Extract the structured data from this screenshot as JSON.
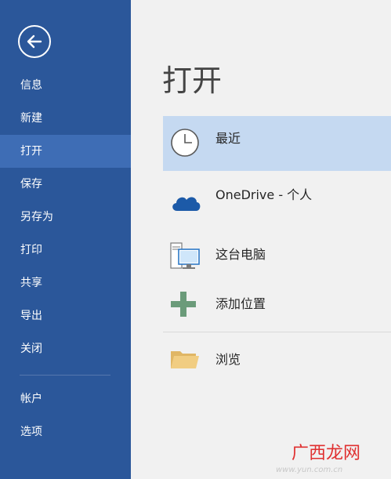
{
  "sidebar": {
    "back_icon": "back-arrow-icon",
    "items": [
      {
        "label": "信息"
      },
      {
        "label": "新建"
      },
      {
        "label": "打开",
        "active": true
      },
      {
        "label": "保存"
      },
      {
        "label": "另存为"
      },
      {
        "label": "打印"
      },
      {
        "label": "共享"
      },
      {
        "label": "导出"
      },
      {
        "label": "关闭"
      }
    ],
    "bottom_items": [
      {
        "label": "帐户"
      },
      {
        "label": "选项"
      }
    ]
  },
  "main": {
    "title": "打开",
    "locations": [
      {
        "label": "最近",
        "icon": "clock-icon",
        "selected": true
      },
      {
        "label": "OneDrive - 个人",
        "icon": "cloud-icon"
      },
      {
        "label": "这台电脑",
        "icon": "computer-icon"
      },
      {
        "label": "添加位置",
        "icon": "plus-icon"
      },
      {
        "label": "浏览",
        "icon": "folder-icon"
      }
    ]
  },
  "watermark": {
    "logo_text": "广西龙网",
    "site": "www.yun.com.cn"
  },
  "colors": {
    "sidebar_bg": "#2b579a",
    "sidebar_active": "#3e6db5",
    "selected_row": "#c5d9f1",
    "main_bg": "#f1f1f1"
  }
}
